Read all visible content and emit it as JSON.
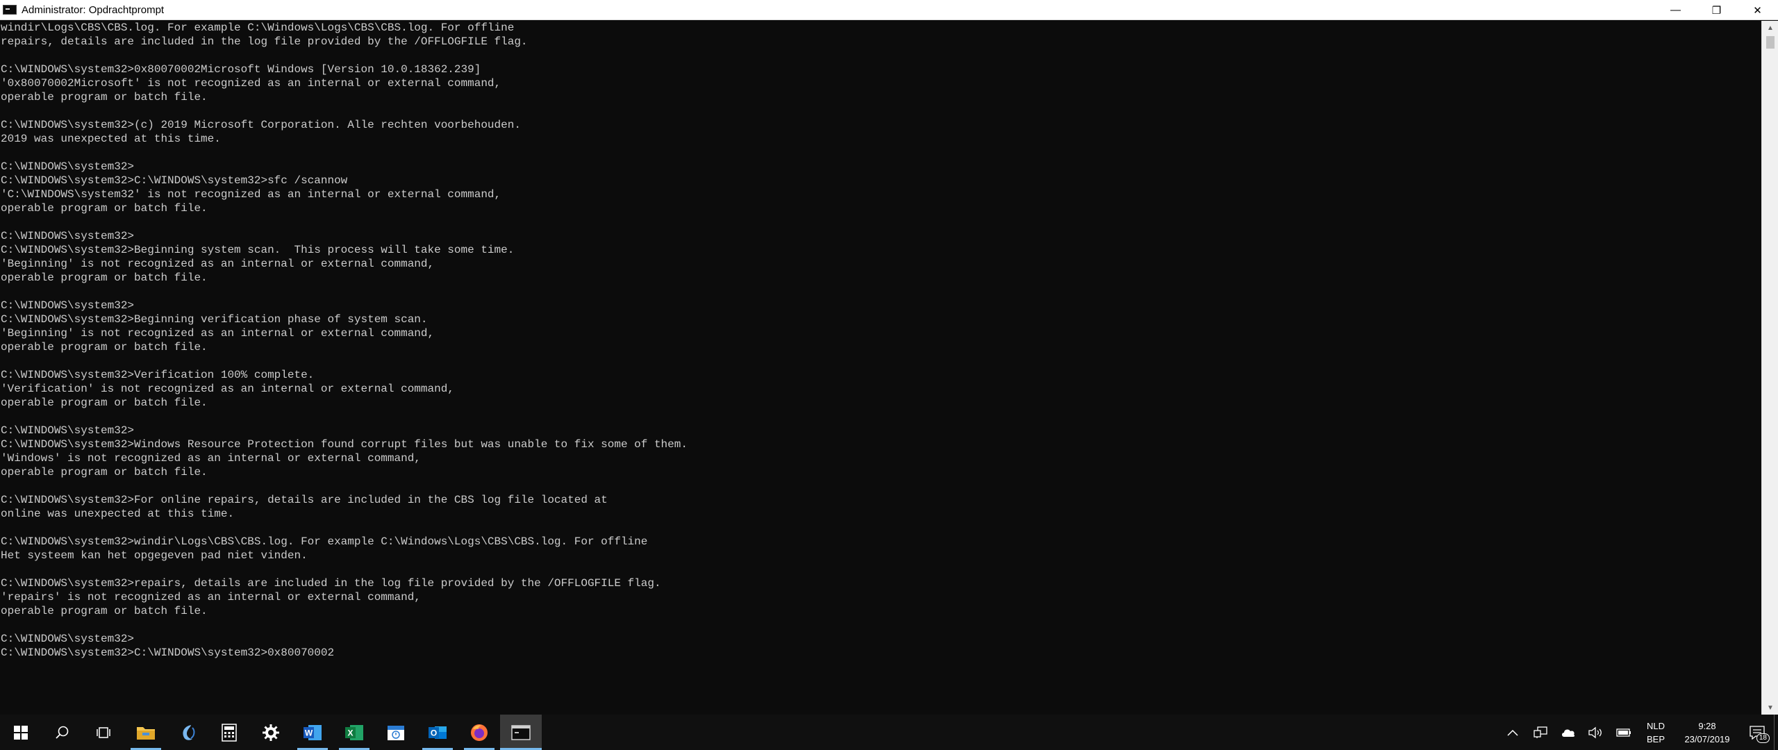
{
  "window": {
    "title": "Administrator: Opdrachtprompt",
    "minimize_glyph": "—",
    "maximize_glyph": "❐",
    "close_glyph": "✕"
  },
  "console": {
    "lines": [
      "windir\\Logs\\CBS\\CBS.log. For example C:\\Windows\\Logs\\CBS\\CBS.log. For offline",
      "repairs, details are included in the log file provided by the /OFFLOGFILE flag.",
      "",
      "C:\\WINDOWS\\system32>0x80070002Microsoft Windows [Version 10.0.18362.239]",
      "'0x80070002Microsoft' is not recognized as an internal or external command,",
      "operable program or batch file.",
      "",
      "C:\\WINDOWS\\system32>(c) 2019 Microsoft Corporation. Alle rechten voorbehouden.",
      "2019 was unexpected at this time.",
      "",
      "C:\\WINDOWS\\system32>",
      "C:\\WINDOWS\\system32>C:\\WINDOWS\\system32>sfc /scannow",
      "'C:\\WINDOWS\\system32' is not recognized as an internal or external command,",
      "operable program or batch file.",
      "",
      "C:\\WINDOWS\\system32>",
      "C:\\WINDOWS\\system32>Beginning system scan.  This process will take some time.",
      "'Beginning' is not recognized as an internal or external command,",
      "operable program or batch file.",
      "",
      "C:\\WINDOWS\\system32>",
      "C:\\WINDOWS\\system32>Beginning verification phase of system scan.",
      "'Beginning' is not recognized as an internal or external command,",
      "operable program or batch file.",
      "",
      "C:\\WINDOWS\\system32>Verification 100% complete.",
      "'Verification' is not recognized as an internal or external command,",
      "operable program or batch file.",
      "",
      "C:\\WINDOWS\\system32>",
      "C:\\WINDOWS\\system32>Windows Resource Protection found corrupt files but was unable to fix some of them.",
      "'Windows' is not recognized as an internal or external command,",
      "operable program or batch file.",
      "",
      "C:\\WINDOWS\\system32>For online repairs, details are included in the CBS log file located at",
      "online was unexpected at this time.",
      "",
      "C:\\WINDOWS\\system32>windir\\Logs\\CBS\\CBS.log. For example C:\\Windows\\Logs\\CBS\\CBS.log. For offline",
      "Het systeem kan het opgegeven pad niet vinden.",
      "",
      "C:\\WINDOWS\\system32>repairs, details are included in the log file provided by the /OFFLOGFILE flag.",
      "'repairs' is not recognized as an internal or external command,",
      "operable program or batch file.",
      "",
      "C:\\WINDOWS\\system32>",
      "C:\\WINDOWS\\system32>C:\\WINDOWS\\system32>0x80070002"
    ]
  },
  "taskbar": {
    "apps": [
      {
        "name": "start",
        "icon": "windows-logo-icon"
      },
      {
        "name": "search",
        "icon": "search-icon"
      },
      {
        "name": "task-view",
        "icon": "task-view-icon"
      },
      {
        "name": "file-explorer",
        "icon": "folder-icon",
        "running": true
      },
      {
        "name": "app-blue-swirl",
        "icon": "swirl-icon"
      },
      {
        "name": "calculator",
        "icon": "calculator-icon"
      },
      {
        "name": "settings",
        "icon": "gear-icon"
      },
      {
        "name": "word",
        "icon": "word-icon",
        "running": true
      },
      {
        "name": "excel",
        "icon": "excel-icon",
        "running": true
      },
      {
        "name": "calendar",
        "icon": "calendar-icon"
      },
      {
        "name": "outlook",
        "icon": "outlook-icon",
        "running": true
      },
      {
        "name": "firefox",
        "icon": "firefox-icon",
        "running": true
      },
      {
        "name": "command-prompt",
        "icon": "terminal-icon",
        "active": true
      }
    ],
    "tray": {
      "language_line1": "NLD",
      "language_line2": "BEP",
      "time": "9:28",
      "date": "23/07/2019",
      "notification_count": "18"
    }
  }
}
